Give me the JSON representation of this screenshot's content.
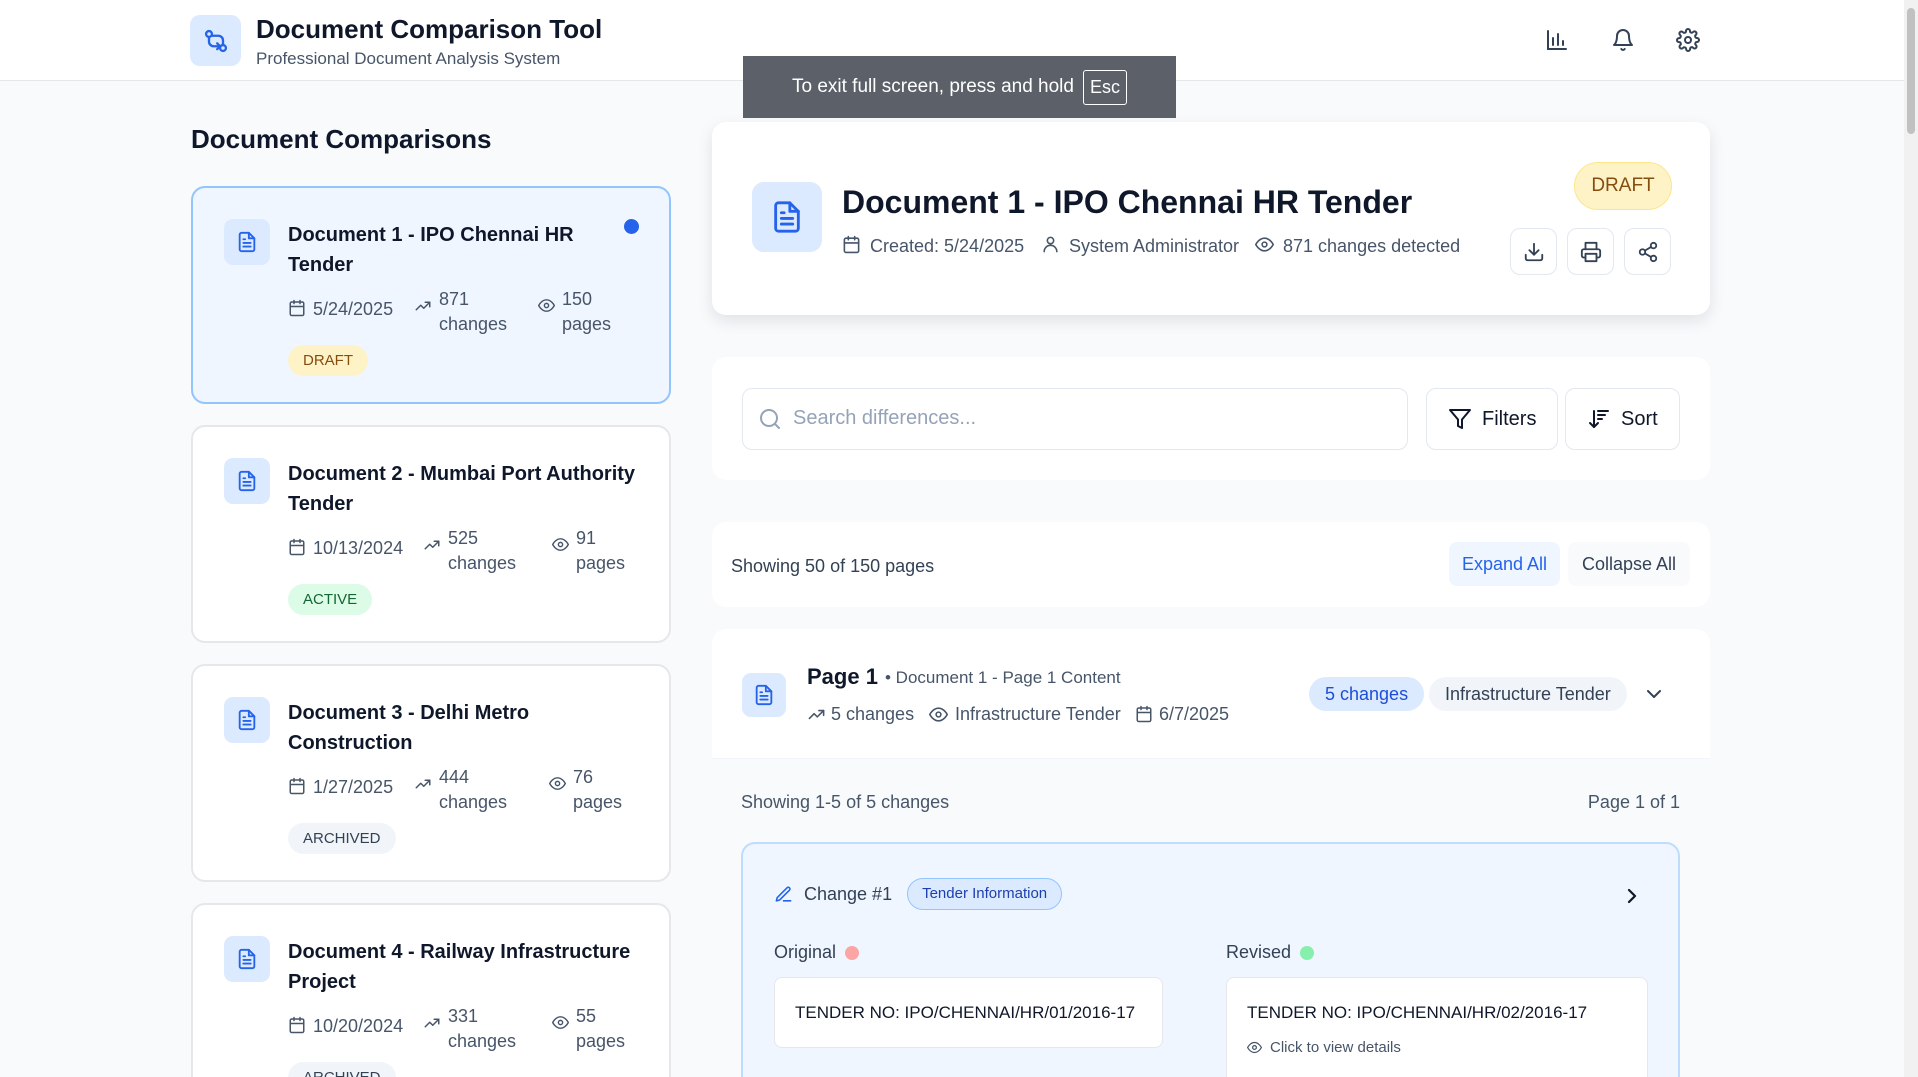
{
  "header": {
    "title": "Document Comparison Tool",
    "subtitle": "Professional Document Analysis System"
  },
  "toast": {
    "text": "To exit full screen, press and hold",
    "key": "Esc"
  },
  "sidebar": {
    "title": "Document Comparisons",
    "documents": [
      {
        "name": "Document 1 - IPO Chennai HR Tender",
        "date": "5/24/2025",
        "changes_num": "871",
        "changes_label": "changes",
        "pages_num": "150",
        "pages_label": "pages",
        "status": "DRAFT"
      },
      {
        "name": "Document 2 - Mumbai Port Authority Tender",
        "date": "10/13/2024",
        "changes_num": "525",
        "changes_label": "changes",
        "pages_num": "91",
        "pages_label": "pages",
        "status": "ACTIVE"
      },
      {
        "name": "Document 3 - Delhi Metro Construction",
        "date": "1/27/2025",
        "changes_num": "444",
        "changes_label": "changes",
        "pages_num": "76",
        "pages_label": "pages",
        "status": "ARCHIVED"
      },
      {
        "name": "Document 4 - Railway Infrastructure Project",
        "date": "10/20/2024",
        "changes_num": "331",
        "changes_label": "changes",
        "pages_num": "55",
        "pages_label": "pages",
        "status": "ARCHIVED"
      }
    ]
  },
  "detail": {
    "title": "Document 1 - IPO Chennai HR Tender",
    "created": "Created: 5/24/2025",
    "author": "System Administrator",
    "changes": "871 changes detected",
    "status": "DRAFT"
  },
  "search": {
    "placeholder": "Search differences...",
    "filters_label": "Filters",
    "sort_label": "Sort"
  },
  "summary": {
    "showing": "Showing 50 of 150 pages",
    "expand_label": "Expand All",
    "collapse_label": "Collapse All"
  },
  "page": {
    "title": "Page 1",
    "subtitle": "• Document 1 - Page 1 Content",
    "changes": "5 changes",
    "category": "Infrastructure Tender",
    "date": "6/7/2025",
    "changes_badge": "5 changes",
    "category_badge": "Infrastructure Tender",
    "changes_info": "Showing 1-5 of 5 changes",
    "page_info": "Page 1 of 1",
    "change": {
      "title": "Change #1",
      "tag": "Tender Information",
      "original_label": "Original",
      "revised_label": "Revised",
      "original_value": "TENDER NO: IPO/CHENNAI/HR/01/2016-17",
      "revised_value": "TENDER NO: IPO/CHENNAI/HR/02/2016-17",
      "hint": "Click to view details"
    }
  },
  "colors": {
    "accent": "#2563eb",
    "draft_bg": "#fef3c7",
    "active_bg": "#dcfce7",
    "archived_bg": "#f1f5f9",
    "original_dot": "#fca5a5",
    "revised_dot": "#86efac"
  },
  "icons": [
    "compare-icon",
    "chart-icon",
    "bell-icon",
    "gear-icon",
    "document-icon",
    "calendar-icon",
    "trend-icon",
    "eye-icon",
    "user-icon",
    "download-icon",
    "print-icon",
    "share-icon",
    "search-icon",
    "filter-icon",
    "sort-icon",
    "chevron-down-icon",
    "chevron-right-icon",
    "pencil-icon"
  ]
}
